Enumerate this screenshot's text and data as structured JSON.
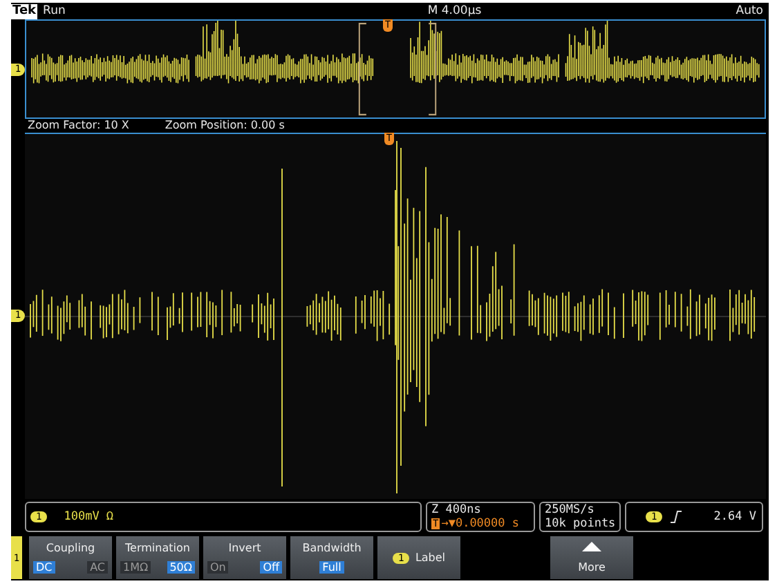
{
  "status": {
    "brand": "Tek",
    "state": "Run",
    "timebase": "M 4.00µs",
    "trigger_mode": "Auto"
  },
  "overview": {
    "channel_marker": "1",
    "trigger_marker": "T"
  },
  "zoom_info": {
    "factor": "Zoom Factor: 10 X",
    "position": "Zoom Position: 0.00 s"
  },
  "main": {
    "channel_marker": "1",
    "trigger_marker": "T"
  },
  "readouts": {
    "channel": {
      "badge": "1",
      "scale": "100mV Ω"
    },
    "horizontal": {
      "scale": "Z 400ns",
      "delay_marker": "T",
      "delay": "→▼0.00000 s"
    },
    "acquisition": {
      "rate": "250MS/s",
      "length": "10k points"
    },
    "trigger": {
      "badge": "1",
      "level": "2.64 V"
    }
  },
  "menu": {
    "channel_tab": "1",
    "buttons": [
      {
        "kind": "toggle",
        "label": "Coupling",
        "options": [
          {
            "label": "DC",
            "selected": true
          },
          {
            "label": "AC",
            "selected": false
          }
        ]
      },
      {
        "kind": "toggle",
        "label": "Termination",
        "options": [
          {
            "label": "1MΩ",
            "selected": false
          },
          {
            "label": "50Ω",
            "selected": true
          }
        ]
      },
      {
        "kind": "toggle",
        "label": "Invert",
        "options": [
          {
            "label": "On",
            "selected": false
          },
          {
            "label": "Off",
            "selected": true
          }
        ]
      },
      {
        "kind": "value",
        "label": "Bandwidth",
        "value": "Full"
      },
      {
        "kind": "label",
        "badge": "1",
        "label": "Label"
      },
      {
        "kind": "more",
        "label": "More"
      }
    ]
  }
}
